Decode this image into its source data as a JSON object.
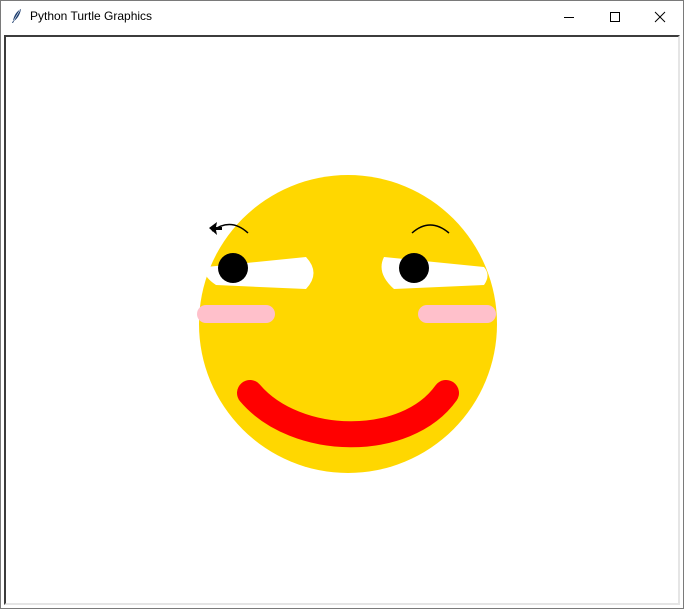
{
  "window": {
    "title": "Python Turtle Graphics",
    "controls": {
      "minimize_icon": "minimize-icon",
      "maximize_icon": "maximize-icon",
      "close_icon": "close-icon"
    }
  },
  "colors": {
    "face": "#FFD700",
    "eye_white": "#FFFFFF",
    "pupil": "#000000",
    "blush": "#FFC0CB",
    "mouth": "#FF0000",
    "brow": "#000000"
  },
  "icons": {
    "app": "feather-icon",
    "turtle_cursor": "arrow-icon"
  }
}
